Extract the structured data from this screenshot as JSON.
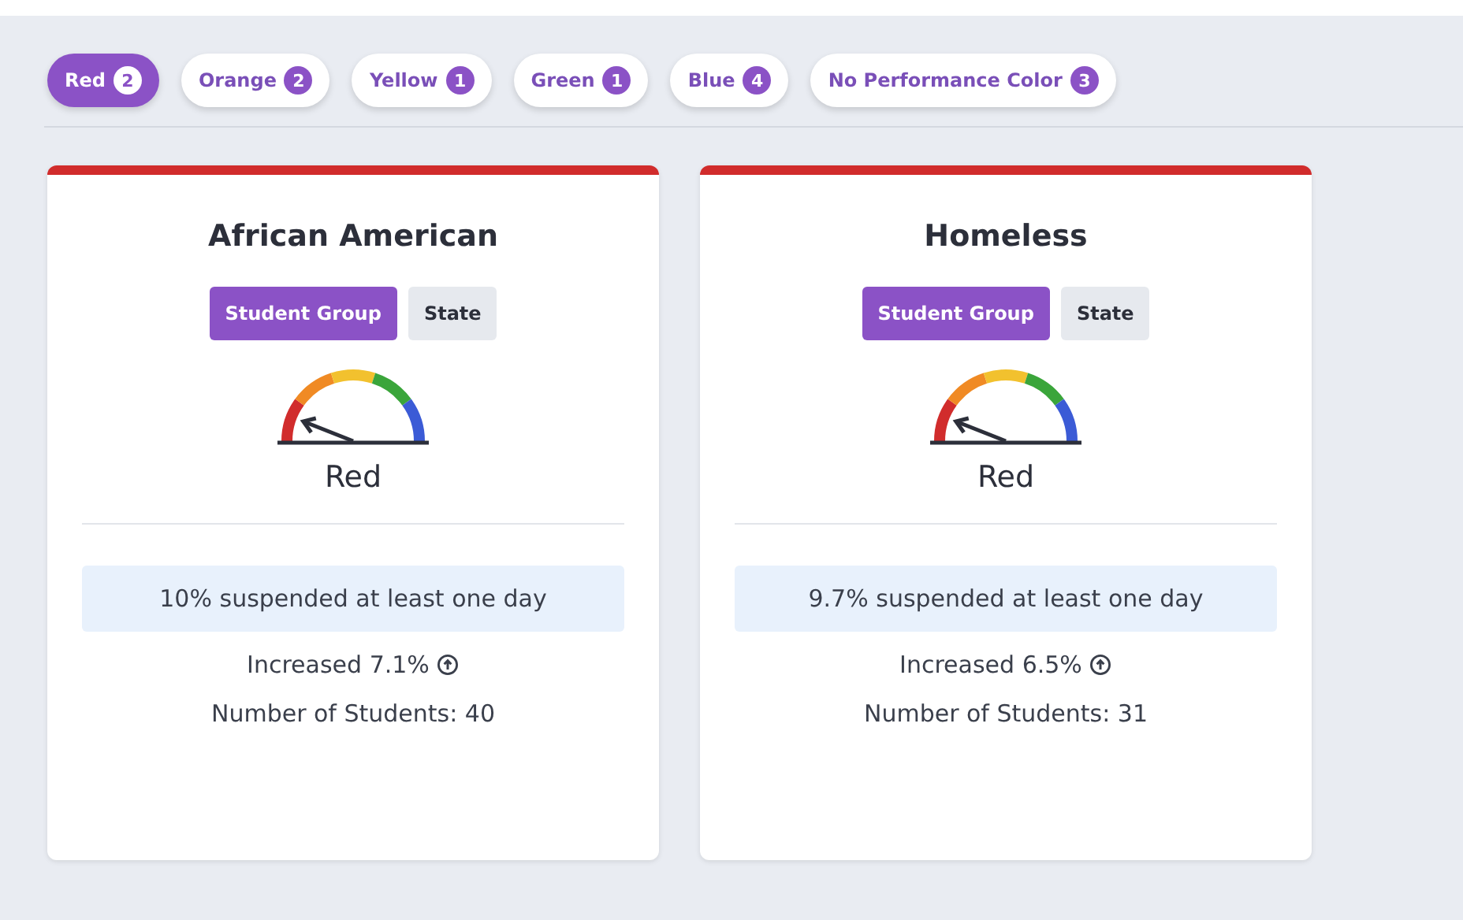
{
  "filters": [
    {
      "label": "Red",
      "count": "2",
      "selected": true
    },
    {
      "label": "Orange",
      "count": "2",
      "selected": false
    },
    {
      "label": "Yellow",
      "count": "1",
      "selected": false
    },
    {
      "label": "Green",
      "count": "1",
      "selected": false
    },
    {
      "label": "Blue",
      "count": "4",
      "selected": false
    },
    {
      "label": "No Performance Color",
      "count": "3",
      "selected": false
    }
  ],
  "cards": [
    {
      "title": "African American",
      "color": "#d12c2c",
      "views": [
        {
          "label": "Student Group",
          "selected": true
        },
        {
          "label": "State",
          "selected": false
        }
      ],
      "rating": "Red",
      "result": "10% suspended at least one day",
      "change": "Increased 7.1%",
      "students": "Number of Students: 40"
    },
    {
      "title": "Homeless",
      "color": "#d12c2c",
      "views": [
        {
          "label": "Student Group",
          "selected": true
        },
        {
          "label": "State",
          "selected": false
        }
      ],
      "rating": "Red",
      "result": "9.7% suspended at least one day",
      "change": "Increased 6.5%",
      "students": "Number of Students: 31"
    }
  ]
}
